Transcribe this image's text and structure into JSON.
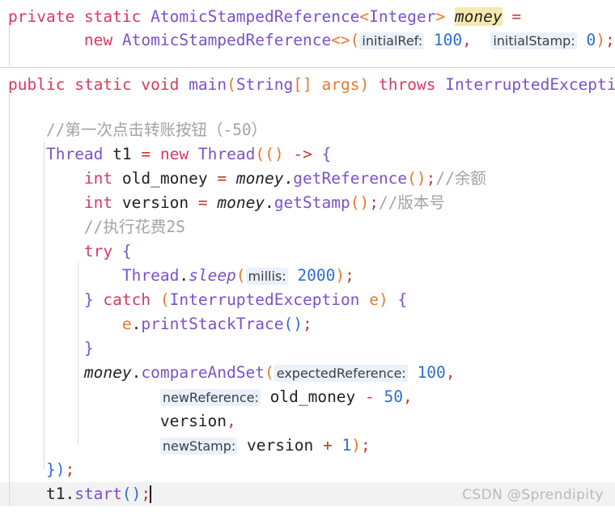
{
  "editor": {
    "app": "intellij-idea-code-editor",
    "theme": "light",
    "language": "Java",
    "colors": {
      "background": "#ffffff",
      "keyword": "#d93a5e",
      "type": "#7a52cc",
      "method": "#7a52cc",
      "number": "#2b6fd4",
      "operator": "#c23a2b",
      "paren": "#e8792b",
      "brace": "#7a52cc",
      "comment": "#a3a3a3",
      "identifier": "#222222",
      "param_hint_bg": "#eaf1fb",
      "ident_highlight_bg": "#f7e9ae",
      "current_line_bg": "#f2f2f2",
      "indent_guide": "#e3d9c6",
      "indent_guide_deep": "#cfdde8",
      "fold_separator": "#d4d4d4",
      "watermark": "#b9b9b9"
    }
  },
  "lines": {
    "l1_private": "private",
    "l1_static": "static",
    "l1_type": "AtomicStampedReference",
    "l1_lt": "<",
    "l1_generic": "Integer",
    "l1_gt": ">",
    "l1_money": "money",
    "l1_eq": "=",
    "l2_new": "new",
    "l2_type": "AtomicStampedReference",
    "l2_diamond": "<>",
    "l2_lparen": "(",
    "l2_hint1": "initialRef:",
    "l2_val1": "100",
    "l2_comma": ",",
    "l2_hint2": "initialStamp:",
    "l2_val2": "0",
    "l2_rparen": ")",
    "l2_semi": ";",
    "l3_public": "public",
    "l3_static": "static",
    "l3_void": "void",
    "l3_main": "main",
    "l3_lparen": "(",
    "l3_string": "String",
    "l3_brackets": "[]",
    "l3_args": "args",
    "l3_rparen": ")",
    "l3_throws": "throws",
    "l3_exc": "InterruptedException",
    "l3_brace": "{",
    "l4_comment": "//第一次点击转账按钮（-50）",
    "l5_thread": "Thread",
    "l5_t1": "t1",
    "l5_eq": "=",
    "l5_new": "new",
    "l5_type": "Thread",
    "l5_lparen": "(",
    "l5_lambda_parens": "()",
    "l5_arrow": "->",
    "l5_brace": "{",
    "l6_int": "int",
    "l6_var": "old_money",
    "l6_eq": "=",
    "l6_money": "money",
    "l6_dot": ".",
    "l6_call": "getReference",
    "l6_parens": "()",
    "l6_semi": ";",
    "l6_comment": "//余额",
    "l7_int": "int",
    "l7_var": "version",
    "l7_eq": "=",
    "l7_money": "money",
    "l7_dot": ".",
    "l7_call": "getStamp",
    "l7_parens": "()",
    "l7_semi": ";",
    "l7_comment": "//版本号",
    "l8_comment": "//执行花费2S",
    "l9_try": "try",
    "l9_brace": "{",
    "l10_thread": "Thread",
    "l10_dot": ".",
    "l10_sleep": "sleep",
    "l10_lparen": "(",
    "l10_hint": "millis:",
    "l10_val": "2000",
    "l10_rparen": ")",
    "l10_semi": ";",
    "l11_rbrace": "}",
    "l11_catch": "catch",
    "l11_lparen": "(",
    "l11_exc": "InterruptedException",
    "l11_e": "e",
    "l11_rparen": ")",
    "l11_brace": "{",
    "l12_e": "e",
    "l12_dot": ".",
    "l12_call": "printStackTrace",
    "l12_parens": "()",
    "l12_semi": ";",
    "l13_rbrace": "}",
    "l14_money": "money",
    "l14_dot": ".",
    "l14_call": "compareAndSet",
    "l14_lparen": "(",
    "l14_hint": "expectedReference:",
    "l14_val": "100",
    "l14_comma": ",",
    "l15_hint": "newReference:",
    "l15_var": "old_money",
    "l15_op": "-",
    "l15_val": "50",
    "l15_comma": ",",
    "l16_var": "version",
    "l16_comma": ",",
    "l17_hint": "newStamp:",
    "l17_var": "version",
    "l17_op": "+",
    "l17_val": "1",
    "l17_rparen": ")",
    "l17_semi": ";",
    "l18_brace": "}",
    "l18_paren": ")",
    "l18_semi": ";",
    "l19_t1": "t1",
    "l19_dot": ".",
    "l19_call": "start",
    "l19_parens": "()",
    "l19_semi": ";"
  },
  "watermark": {
    "text": "CSDN @Sprendipity"
  }
}
